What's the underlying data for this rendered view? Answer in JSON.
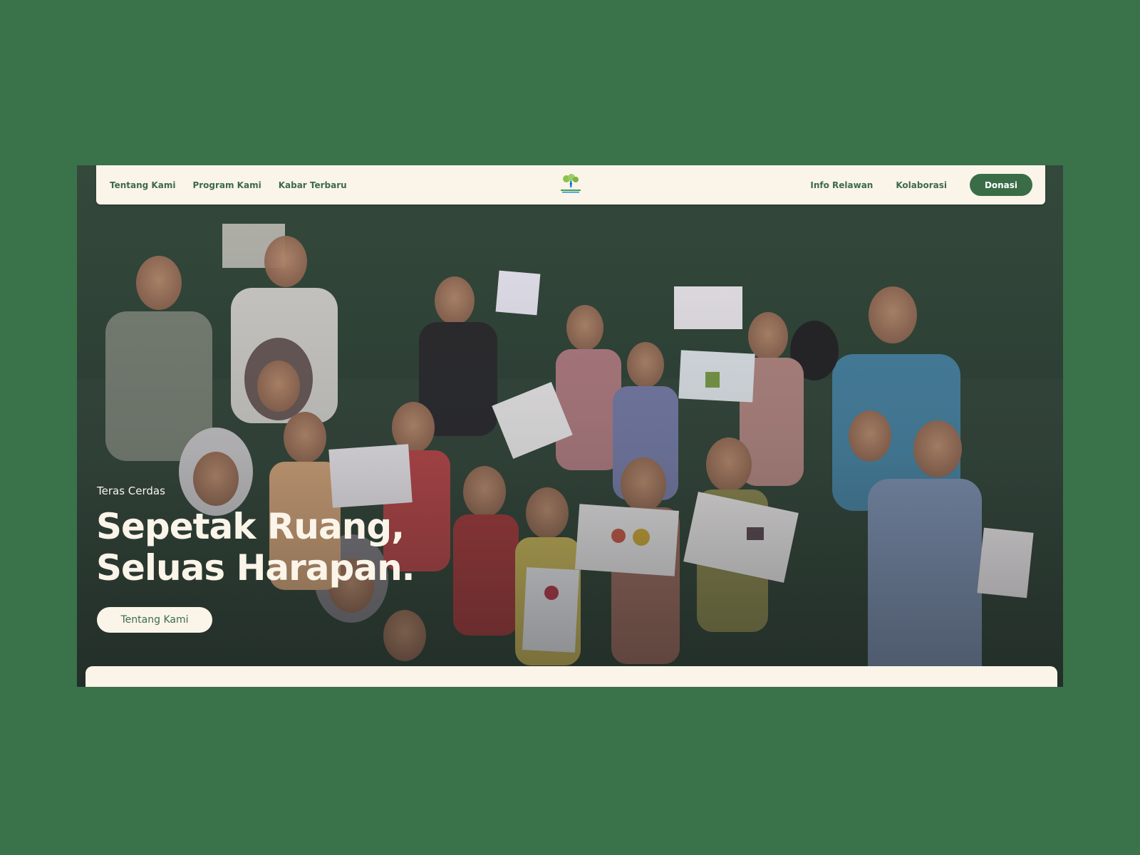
{
  "nav": {
    "left_links": [
      "Tentang Kami",
      "Program Kami",
      "Kabar Terbaru"
    ],
    "right_links": [
      "Info Relawan",
      "Kolaborasi"
    ],
    "donate_label": "Donasi",
    "logo_icon": "tree-logo-icon"
  },
  "hero": {
    "eyebrow": "Teras Cerdas",
    "title_line1": "Sepetak Ruang,",
    "title_line2": "Seluas Harapan.",
    "button_label": "Tentang Kami",
    "image": "group-photo-children-with-drawings"
  },
  "colors": {
    "page_background": "#3a724a",
    "nav_background": "#fbf4e9",
    "accent_green": "#3a6d47",
    "cream": "#fbf4e9"
  }
}
